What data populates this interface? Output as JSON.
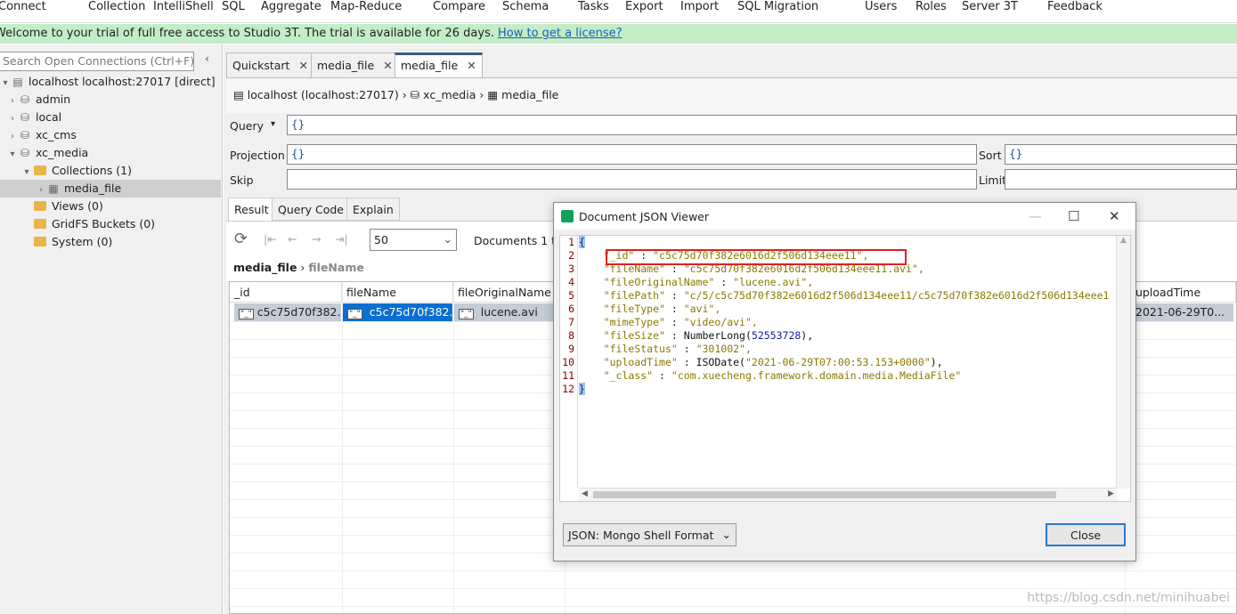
{
  "menu": [
    "Connect",
    "Collection",
    "IntelliShell",
    "SQL",
    "Aggregate",
    "Map-Reduce",
    "Compare",
    "Schema",
    "Tasks",
    "Export",
    "Import",
    "SQL Migration",
    "Users",
    "Roles",
    "Server 3T",
    "Feedback"
  ],
  "banner": {
    "text": "Welcome to your trial of full free access to Studio 3T. The trial is available for 26 days.",
    "link": "How to get a license?"
  },
  "sidebar": {
    "search_placeholder": "Search Open Connections (Ctrl+F) ...",
    "items": [
      {
        "label": "localhost localhost:27017 [direct]"
      },
      {
        "label": "admin"
      },
      {
        "label": "local"
      },
      {
        "label": "xc_cms"
      },
      {
        "label": "xc_media"
      },
      {
        "label": "Collections (1)"
      },
      {
        "label": "media_file"
      },
      {
        "label": "Views (0)"
      },
      {
        "label": "GridFS Buckets (0)"
      },
      {
        "label": "System (0)"
      }
    ]
  },
  "tabs": [
    {
      "label": "Quickstart"
    },
    {
      "label": "media_file"
    },
    {
      "label": "media_file"
    }
  ],
  "breadcrumb": {
    "server": "localhost (localhost:27017)",
    "db": "xc_media",
    "collection": "media_file"
  },
  "query": {
    "query_label": "Query",
    "query_value": "{}",
    "projection_label": "Projection",
    "projection_value": "{}",
    "sort_label": "Sort",
    "sort_value": "{}",
    "skip_label": "Skip",
    "skip_value": "",
    "limit_label": "Limit",
    "limit_value": ""
  },
  "result_tabs": [
    "Result",
    "Query Code",
    "Explain"
  ],
  "toolbar": {
    "page_size": "50",
    "documents": "Documents 1 to"
  },
  "path": {
    "collection": "media_file",
    "field": "fileName"
  },
  "grid": {
    "columns": [
      "_id",
      "fileName",
      "fileOriginalName",
      "uploadTime"
    ],
    "row": [
      "c5c75d70f382...",
      "c5c75d70f382...",
      "lucene.avi",
      "2021-06-29T0..."
    ]
  },
  "dialog": {
    "title": "Document JSON Viewer",
    "format": "JSON: Mongo Shell Format",
    "close": "Close",
    "lines": [
      "1",
      "2",
      "3",
      "4",
      "5",
      "6",
      "7",
      "8",
      "9",
      "10",
      "11",
      "12"
    ],
    "fields": [
      {
        "key": "\"_id\"",
        "value": "\"c5c75d70f382e6016d2f506d134eee11\","
      },
      {
        "key": "\"fileName\"",
        "value": "\"c5c75d70f382e6016d2f506d134eee11.avi\","
      },
      {
        "key": "\"fileOriginalName\"",
        "value": "\"lucene.avi\","
      },
      {
        "key": "\"filePath\"",
        "value": "\"c/5/c5c75d70f382e6016d2f506d134eee11/c5c75d70f382e6016d2f506d134eee1"
      },
      {
        "key": "\"fileType\"",
        "value": "\"avi\","
      },
      {
        "key": "\"mimeType\"",
        "value": "\"video/avi\","
      },
      {
        "key": "\"fileSize\"",
        "fn": "NumberLong(",
        "num": "52553728",
        "tail": "),"
      },
      {
        "key": "\"fileStatus\"",
        "value": "\"301002\","
      },
      {
        "key": "\"uploadTime\"",
        "fn": "ISODate(",
        "str": "\"2021-06-29T07:00:53.153+0000\"",
        "tail": "),"
      },
      {
        "key": "\"_class\"",
        "value": "\"com.xuecheng.framework.domain.media.MediaFile\""
      }
    ],
    "open_brace": "{",
    "close_brace": "}"
  },
  "watermark": "https://blog.csdn.net/minihuabei"
}
